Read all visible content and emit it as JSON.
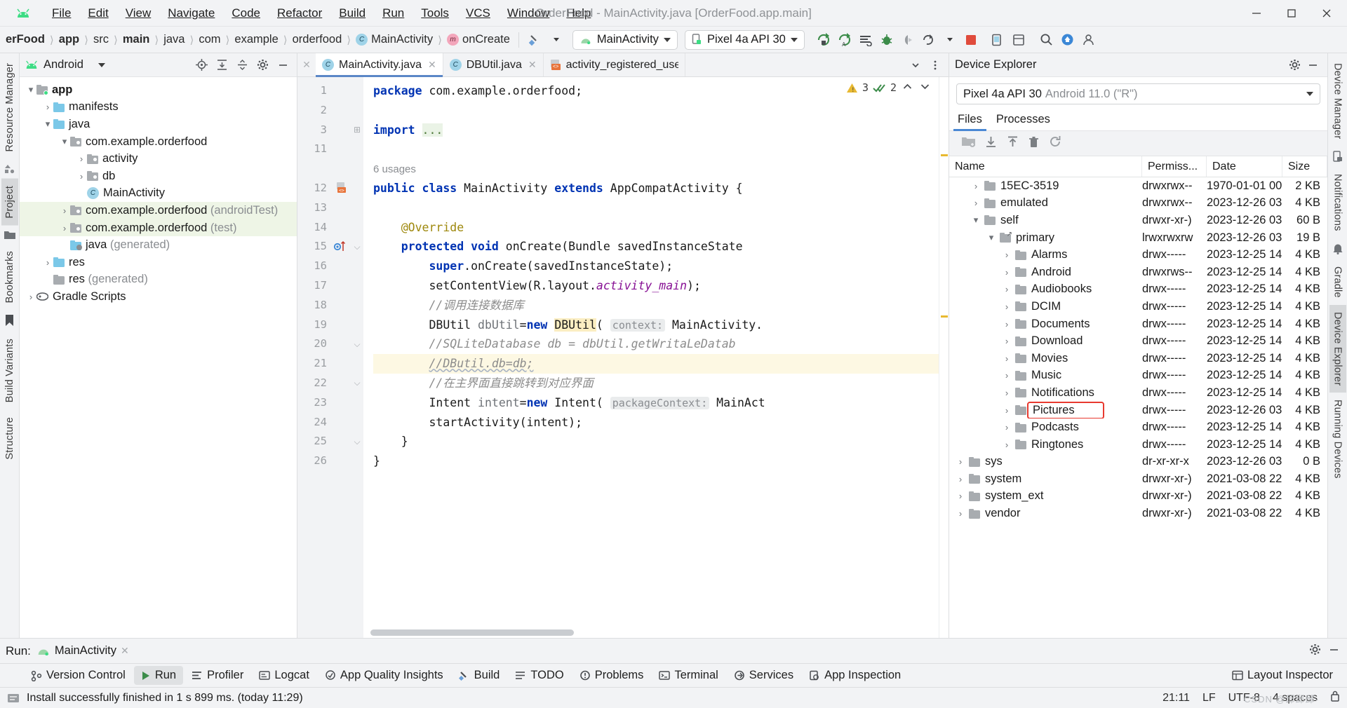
{
  "window": {
    "title": "OrderFood - MainActivity.java [OrderFood.app.main]",
    "minimize": "minimize-icon",
    "maximize": "maximize-icon",
    "close": "close-icon"
  },
  "menu": [
    {
      "label": "File"
    },
    {
      "label": "Edit"
    },
    {
      "label": "View"
    },
    {
      "label": "Navigate"
    },
    {
      "label": "Code"
    },
    {
      "label": "Refactor"
    },
    {
      "label": "Build"
    },
    {
      "label": "Run"
    },
    {
      "label": "Tools"
    },
    {
      "label": "VCS"
    },
    {
      "label": "Window"
    },
    {
      "label": "Help"
    }
  ],
  "breadcrumbs": [
    {
      "label": "erFood",
      "bold": true
    },
    {
      "label": "app",
      "bold": true
    },
    {
      "label": "src",
      "bold": false
    },
    {
      "label": "main",
      "bold": true
    },
    {
      "label": "java",
      "bold": false
    },
    {
      "label": "com",
      "bold": false
    },
    {
      "label": "example",
      "bold": false
    },
    {
      "label": "orderfood",
      "bold": false
    },
    {
      "label": "MainActivity",
      "bold": false,
      "badge": "C"
    },
    {
      "label": "onCreate",
      "bold": false,
      "badge": "m"
    }
  ],
  "toolbar": {
    "run_config": "MainActivity",
    "device": "Pixel 4a API 30",
    "icons": [
      "hammer-icon",
      "run-icon",
      "run-with-coverage-icon",
      "profiler-icon",
      "debug-icon",
      "attach-debugger-icon",
      "more-run-icon",
      "stop-icon",
      "avd-manager-icon",
      "layout-inspector-icon",
      "search-icon",
      "update-icon",
      "account-icon"
    ]
  },
  "project_pane": {
    "title": "Android",
    "header_icons": [
      "locate-icon",
      "expand-all-icon",
      "collapse-all-icon",
      "settings-icon",
      "hide-icon"
    ],
    "tree": [
      {
        "label": "app",
        "depth": 0,
        "arrow": "down",
        "icon": "module-folder",
        "bold": true,
        "suffix": ""
      },
      {
        "label": "manifests",
        "depth": 1,
        "arrow": "right",
        "icon": "blue-folder",
        "bold": false,
        "suffix": ""
      },
      {
        "label": "java",
        "depth": 1,
        "arrow": "down",
        "icon": "blue-folder",
        "bold": false,
        "suffix": ""
      },
      {
        "label": "com.example.orderfood",
        "depth": 2,
        "arrow": "down",
        "icon": "package-folder",
        "bold": false,
        "suffix": ""
      },
      {
        "label": "activity",
        "depth": 3,
        "arrow": "right",
        "icon": "package-folder",
        "bold": false,
        "suffix": ""
      },
      {
        "label": "db",
        "depth": 3,
        "arrow": "right",
        "icon": "package-folder",
        "bold": false,
        "suffix": ""
      },
      {
        "label": "MainActivity",
        "depth": 3,
        "arrow": "none",
        "icon": "class-icon",
        "bold": false,
        "suffix": ""
      },
      {
        "label": "com.example.orderfood",
        "depth": 2,
        "arrow": "right",
        "icon": "package-folder",
        "bold": false,
        "suffix": " (androidTest)",
        "highlight": true
      },
      {
        "label": "com.example.orderfood",
        "depth": 2,
        "arrow": "right",
        "icon": "package-folder",
        "bold": false,
        "suffix": " (test)",
        "highlight": true
      },
      {
        "label": "java",
        "depth": 2,
        "arrow": "none",
        "icon": "generated-folder",
        "bold": false,
        "suffix": " (generated)"
      },
      {
        "label": "res",
        "depth": 1,
        "arrow": "right",
        "icon": "blue-folder",
        "bold": false,
        "suffix": ""
      },
      {
        "label": "res",
        "depth": 1,
        "arrow": "none",
        "icon": "generated-folder",
        "bold": false,
        "suffix": " (generated)"
      },
      {
        "label": "Gradle Scripts",
        "depth": 0,
        "arrow": "right",
        "icon": "gradle-icon",
        "bold": false,
        "suffix": ""
      }
    ]
  },
  "editor": {
    "tabs": [
      {
        "label": "MainActivity.java",
        "icon": "class-icon",
        "active": true
      },
      {
        "label": "DBUtil.java",
        "icon": "class-icon",
        "active": false
      },
      {
        "label": "activity_registered_use",
        "icon": "layout-icon",
        "active": false
      }
    ],
    "inspections": {
      "warnings": "3",
      "checks": "2"
    },
    "usages_label": "6 usages",
    "lines": [
      {
        "n": "1",
        "html": "<span class='kw'>package</span> com.example.orderfood;"
      },
      {
        "n": "2",
        "html": ""
      },
      {
        "n": "3",
        "html": "<span class='kw'>import</span> <span class='dots'>...</span>",
        "fold": "plus"
      },
      {
        "n": "11",
        "html": ""
      },
      {
        "n": "",
        "html": "<span class='usages'>6 usages</span>"
      },
      {
        "n": "12",
        "html": "<span class='kw'>public class</span> MainActivity <span class='kw'>extends</span> AppCompatActivity {",
        "gicon": "layout-marker"
      },
      {
        "n": "13",
        "html": ""
      },
      {
        "n": "14",
        "html": "    <span class='an'>@Override</span>"
      },
      {
        "n": "15",
        "html": "    <span class='kw'>protected void</span> onCreate(Bundle savedInstanceState",
        "gicon": "override-marker",
        "fold": "minus"
      },
      {
        "n": "16",
        "html": "        <span class='kw'>super</span>.onCreate(savedInstanceState);"
      },
      {
        "n": "17",
        "html": "        setContentView(R.layout.<span class='fld'>activity_main</span>);"
      },
      {
        "n": "18",
        "html": "        <span class='cm'>//调用连接数据库</span>"
      },
      {
        "n": "19",
        "html": "        DBUtil dbUtil=<span class='kw'>new</span> <span class='hlw'>DBUtil</span>( <span class='hint'>context:</span> MainActivity."
      },
      {
        "n": "20",
        "html": "        <span class='cm'>//SQLiteDatabase db = dbUtil.getWritaLeDatab</span>",
        "fold": "minus"
      },
      {
        "n": "21",
        "html": "        <span class='cm'>//DButil.db=db;</span>",
        "highlight": true
      },
      {
        "n": "22",
        "html": "        <span class='cm'>//在主界面直接跳转到对应界面</span>",
        "fold": "minus"
      },
      {
        "n": "23",
        "html": "        Intent intent=<span class='kw'>new</span> Intent( <span class='hint'>packageContext:</span> MainAct"
      },
      {
        "n": "24",
        "html": "        startActivity(intent);"
      },
      {
        "n": "25",
        "html": "    }",
        "fold": "minus"
      },
      {
        "n": "26",
        "html": "}"
      }
    ]
  },
  "device_explorer": {
    "title": "Device Explorer",
    "device": "Pixel 4a API 30",
    "device_dim": "Android 11.0 (\"R\")",
    "tabs": [
      {
        "label": "Files",
        "active": true
      },
      {
        "label": "Processes",
        "active": false
      }
    ],
    "toolbar_icons": [
      "new-folder-icon",
      "download-icon",
      "upload-icon",
      "delete-icon",
      "refresh-icon"
    ],
    "columns": [
      "Name",
      "Permiss...",
      "Date",
      "Size"
    ],
    "rows": [
      {
        "name": "15EC-3519",
        "depth": 1,
        "arrow": "right",
        "perm": "drwxrwx--",
        "date": "1970-01-01 00",
        "size": "2 KB",
        "link": false
      },
      {
        "name": "emulated",
        "depth": 1,
        "arrow": "right",
        "perm": "drwxrwx--",
        "date": "2023-12-26 03",
        "size": "4 KB",
        "link": false
      },
      {
        "name": "self",
        "depth": 1,
        "arrow": "down",
        "perm": "drwxr-xr-)",
        "date": "2023-12-26 03",
        "size": "60 B",
        "link": false
      },
      {
        "name": "primary",
        "depth": 2,
        "arrow": "down",
        "perm": "lrwxrwxrw",
        "date": "2023-12-26 03",
        "size": "19 B",
        "link": true
      },
      {
        "name": "Alarms",
        "depth": 3,
        "arrow": "right",
        "perm": "drwx-----",
        "date": "2023-12-25 14",
        "size": "4 KB",
        "link": false
      },
      {
        "name": "Android",
        "depth": 3,
        "arrow": "right",
        "perm": "drwxrws--",
        "date": "2023-12-25 14",
        "size": "4 KB",
        "link": false
      },
      {
        "name": "Audiobooks",
        "depth": 3,
        "arrow": "right",
        "perm": "drwx-----",
        "date": "2023-12-25 14",
        "size": "4 KB",
        "link": false
      },
      {
        "name": "DCIM",
        "depth": 3,
        "arrow": "right",
        "perm": "drwx-----",
        "date": "2023-12-25 14",
        "size": "4 KB",
        "link": false
      },
      {
        "name": "Documents",
        "depth": 3,
        "arrow": "right",
        "perm": "drwx-----",
        "date": "2023-12-25 14",
        "size": "4 KB",
        "link": false
      },
      {
        "name": "Download",
        "depth": 3,
        "arrow": "right",
        "perm": "drwx-----",
        "date": "2023-12-25 14",
        "size": "4 KB",
        "link": false
      },
      {
        "name": "Movies",
        "depth": 3,
        "arrow": "right",
        "perm": "drwx-----",
        "date": "2023-12-25 14",
        "size": "4 KB",
        "link": false
      },
      {
        "name": "Music",
        "depth": 3,
        "arrow": "right",
        "perm": "drwx-----",
        "date": "2023-12-25 14",
        "size": "4 KB",
        "link": false
      },
      {
        "name": "Notifications",
        "depth": 3,
        "arrow": "right",
        "perm": "drwx-----",
        "date": "2023-12-25 14",
        "size": "4 KB",
        "link": false
      },
      {
        "name": "Pictures",
        "depth": 3,
        "arrow": "right",
        "perm": "drwx-----",
        "date": "2023-12-26 03",
        "size": "4 KB",
        "link": false,
        "selected": true
      },
      {
        "name": "Podcasts",
        "depth": 3,
        "arrow": "right",
        "perm": "drwx-----",
        "date": "2023-12-25 14",
        "size": "4 KB",
        "link": false
      },
      {
        "name": "Ringtones",
        "depth": 3,
        "arrow": "right",
        "perm": "drwx-----",
        "date": "2023-12-25 14",
        "size": "4 KB",
        "link": false
      },
      {
        "name": "sys",
        "depth": 0,
        "arrow": "right",
        "perm": "dr-xr-xr-x",
        "date": "2023-12-26 03",
        "size": "0 B",
        "link": false
      },
      {
        "name": "system",
        "depth": 0,
        "arrow": "right",
        "perm": "drwxr-xr-)",
        "date": "2021-03-08 22",
        "size": "4 KB",
        "link": false
      },
      {
        "name": "system_ext",
        "depth": 0,
        "arrow": "right",
        "perm": "drwxr-xr-)",
        "date": "2021-03-08 22",
        "size": "4 KB",
        "link": false
      },
      {
        "name": "vendor",
        "depth": 0,
        "arrow": "right",
        "perm": "drwxr-xr-)",
        "date": "2021-03-08 22",
        "size": "4 KB",
        "link": false
      }
    ]
  },
  "run_panel": {
    "label": "Run:",
    "config": "MainActivity",
    "close": "close-icon",
    "settings": "settings-icon",
    "minimize": "minimize-icon"
  },
  "bottom_tabs": [
    {
      "label": "Version Control",
      "icon": "version-control-icon",
      "active": false
    },
    {
      "label": "Run",
      "icon": "run-icon",
      "active": true
    },
    {
      "label": "Profiler",
      "icon": "profiler-icon",
      "active": false
    },
    {
      "label": "Logcat",
      "icon": "logcat-icon",
      "active": false
    },
    {
      "label": "App Quality Insights",
      "icon": "insights-icon",
      "active": false
    },
    {
      "label": "Build",
      "icon": "build-icon",
      "active": false
    },
    {
      "label": "TODO",
      "icon": "todo-icon",
      "active": false
    },
    {
      "label": "Problems",
      "icon": "problems-icon",
      "active": false
    },
    {
      "label": "Terminal",
      "icon": "terminal-icon",
      "active": false
    },
    {
      "label": "Services",
      "icon": "services-icon",
      "active": false
    },
    {
      "label": "App Inspection",
      "icon": "app-inspection-icon",
      "active": false
    }
  ],
  "bottom_right": {
    "label": "Layout Inspector",
    "icon": "layout-inspector-icon"
  },
  "statusbar": {
    "message": "Install successfully finished in 1 s 899 ms. (today 11:29)",
    "icon": "info-icon",
    "position": "21:11",
    "line_sep": "LF",
    "encoding": "UTF-8",
    "indent": "4 spaces",
    "watermark": "CSDN @邱邱邱-"
  },
  "left_rail": [
    {
      "label": "Resource Manager",
      "active": false
    },
    {
      "label": "Project",
      "active": true
    },
    {
      "label": "Bookmarks",
      "active": false
    },
    {
      "label": "Build Variants",
      "active": false
    },
    {
      "label": "Structure",
      "active": false
    }
  ],
  "right_rail": [
    {
      "label": "Device Manager",
      "active": false
    },
    {
      "label": "Notifications",
      "active": false
    },
    {
      "label": "Gradle",
      "active": false
    },
    {
      "label": "Device Explorer",
      "active": true
    },
    {
      "label": "Running Devices",
      "active": false
    }
  ]
}
